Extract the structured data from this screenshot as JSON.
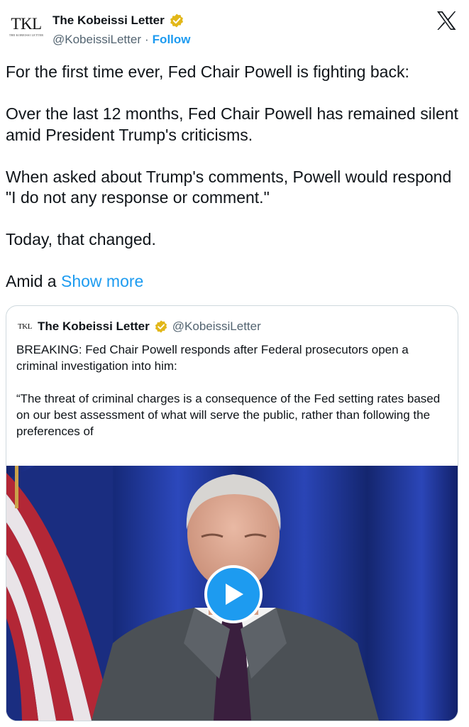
{
  "author": {
    "avatar_text": "TKL",
    "avatar_subtext": "THE KOBEISSI LETTER",
    "display_name": "The Kobeissi Letter",
    "handle": "@KobeissiLetter",
    "separator": "·",
    "follow_label": "Follow",
    "verified_icon": "verified-badge-gold"
  },
  "platform_icon": "x-logo",
  "post": {
    "paragraphs": [
      "For the first time ever, Fed Chair Powell is fighting back:",
      "Over the last 12 months, Fed Chair Powell has remained silent amid President Trump's criticisms.",
      "When asked about Trump's comments, Powell would respond \"I do not any response or comment.\"",
      "Today, that changed."
    ],
    "truncated_prefix": "Amid a",
    "show_more_label": "Show more"
  },
  "quote": {
    "avatar_text": "TKL",
    "display_name": "The Kobeissi Letter",
    "handle": "@KobeissiLetter",
    "paragraphs": [
      "BREAKING: Fed Chair Powell responds after Federal prosecutors open a criminal investigation into him:",
      "“The threat of criminal charges is a consequence of the Fed setting rates based on our best assessment of what will serve the public, rather than following the preferences of"
    ],
    "media": {
      "type": "video",
      "play_icon": "play-icon"
    }
  },
  "colors": {
    "link": "#1d9bf0",
    "secondary_text": "#536471",
    "verified": "#e2b719",
    "border": "#cfd9de",
    "curtain": "#1c2f86"
  }
}
